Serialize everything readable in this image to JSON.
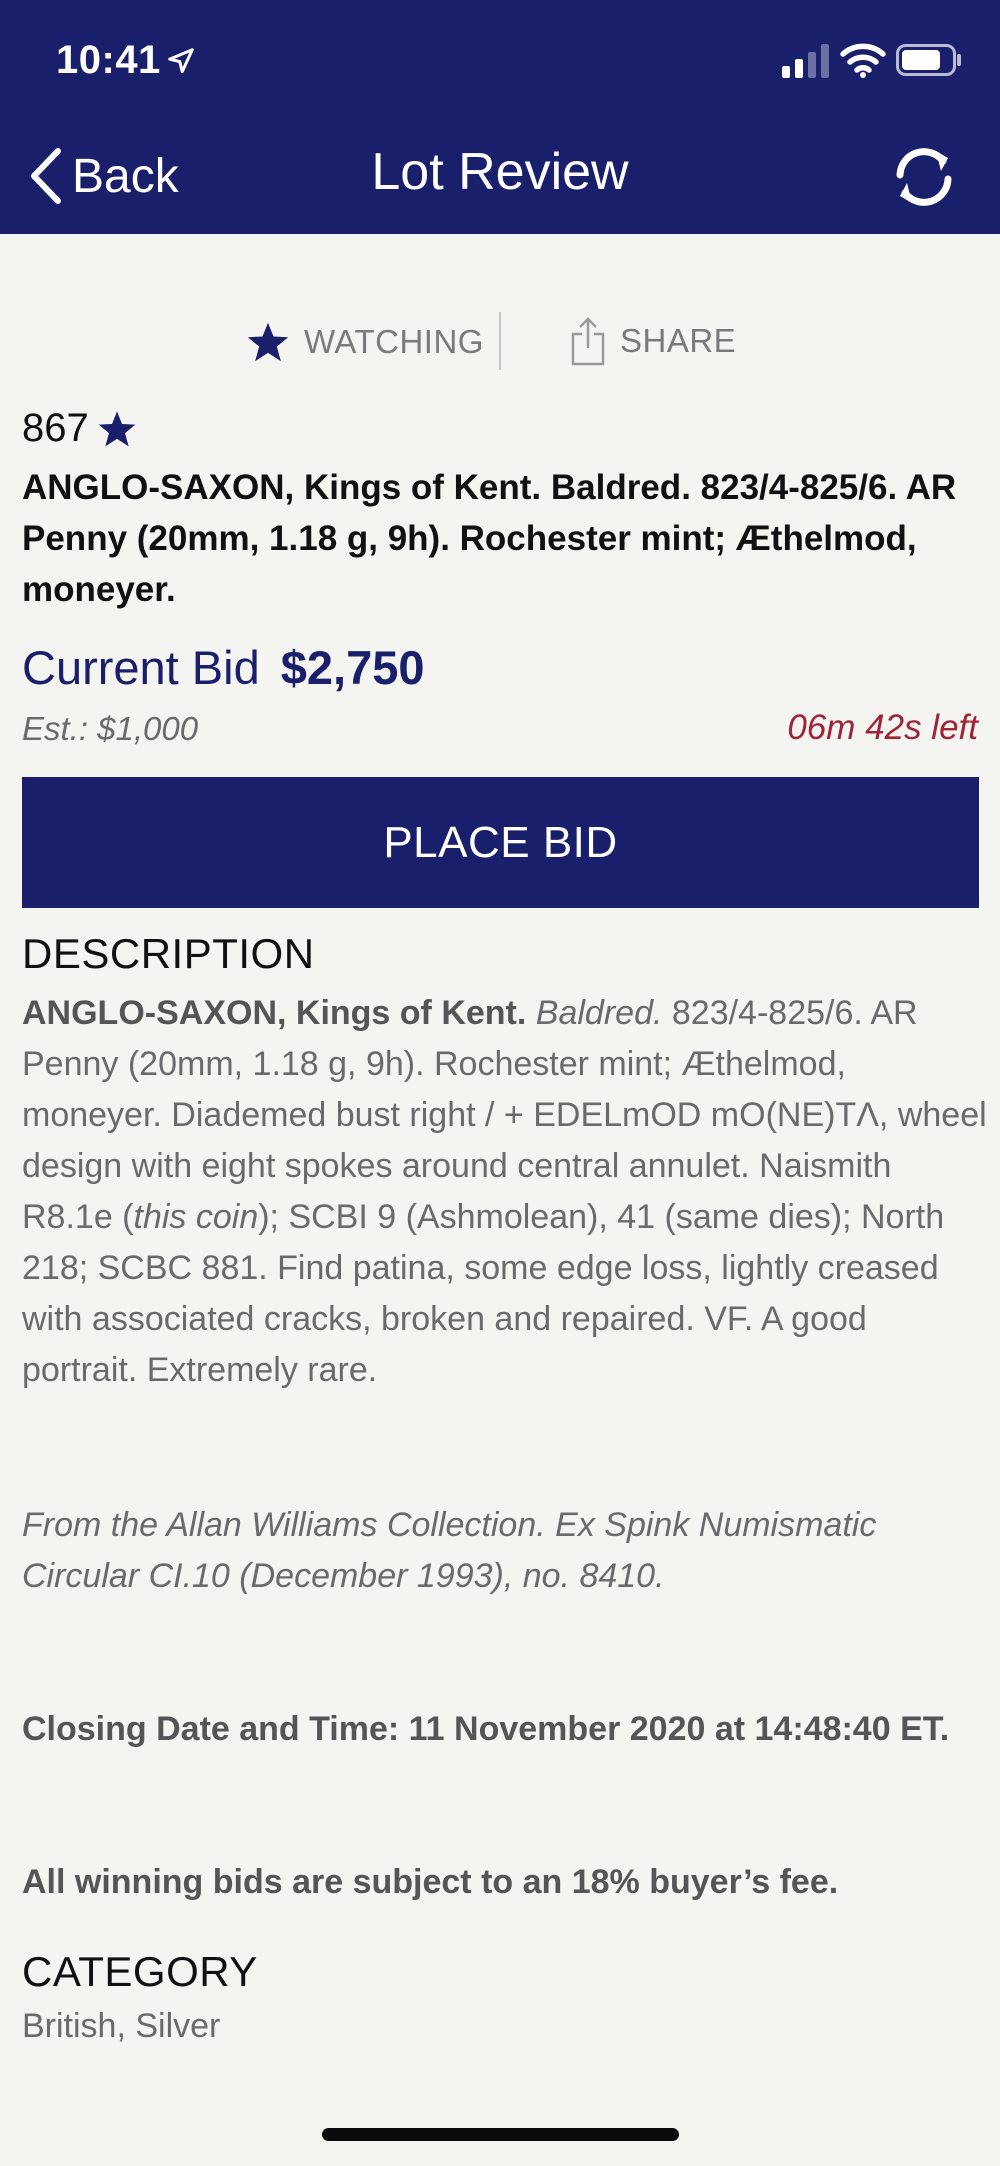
{
  "status_bar": {
    "time": "10:41"
  },
  "nav": {
    "back_label": "Back",
    "title": "Lot Review"
  },
  "actions": {
    "watching_label": "WATCHING",
    "share_label": "SHARE"
  },
  "lot": {
    "number": "867",
    "title": "ANGLO-SAXON, Kings of Kent. Baldred. 823/4-825/6. AR Penny (20mm, 1.18 g, 9h). Rochester mint; Æthelmod, moneyer.",
    "current_bid_label": "Current Bid",
    "current_bid_amount": "$2,750",
    "estimate": "Est.: $1,000",
    "time_left": "06m 42s left",
    "place_bid_label": "PLACE BID"
  },
  "description": {
    "heading": "DESCRIPTION",
    "bold_intro": "ANGLO-SAXON, Kings of Kent.",
    "ruler_italic": "Baldred.",
    "text_part1": "823/4-825/6. AR Penny (20mm, 1.18 g, 9h). Rochester mint; Æthelmod, moneyer. Diademed bust right / + EDELmOD mO(NE)TΛ, wheel design with eight spokes around central annulet. Naismith R8.1e (",
    "italic_ref": "this coin",
    "text_part2": "); SCBI 9 (Ashmolean), 41 (same dies); North 218; SCBC 881. Find patina, some edge loss, lightly creased with associated cracks, broken and repaired. VF. A good portrait. Extremely rare.",
    "provenance": "From the Allan Williams Collection. Ex Spink Numismatic Circular CI.10 (December 1993), no. 8410.",
    "closing": "Closing Date and Time: 11 November 2020 at 14:48:40 ET.",
    "fee": "All winning bids are subject to an 18% buyer’s fee."
  },
  "category": {
    "heading": "CATEGORY",
    "value": "British, Silver"
  },
  "colors": {
    "brand_navy": "#1a1f6b",
    "time_left_red": "#a12336",
    "background": "#f4f4f1"
  },
  "icons": {
    "back": "chevron-left-icon",
    "refresh": "refresh-icon",
    "watching": "star-icon",
    "share": "share-icon"
  }
}
